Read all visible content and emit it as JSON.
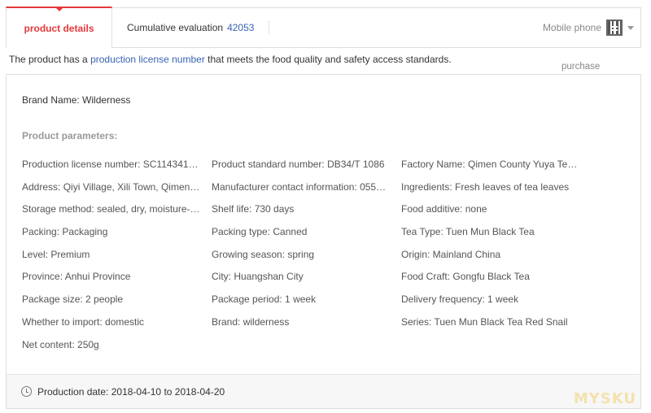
{
  "tabs": {
    "active_label": "product details",
    "eval_label": "Cumulative evaluation",
    "eval_count": "42053",
    "mobile_label": "Mobile phone"
  },
  "license": {
    "prefix": "The product has a ",
    "link": "production license number",
    "suffix": " that meets the food quality and safety access standards."
  },
  "purchase_label": "purchase",
  "brand": "Brand Name: Wilderness",
  "params_title": "Product parameters:",
  "params": [
    "Production license number: SC1143410…",
    "Product standard number: DB34/T 1086",
    "Factory Name: Qimen County Yuya Tea…",
    "Address: Qiyi Village, Xili Town, Qimen …",
    "Manufacturer contact information: 055…",
    "Ingredients: Fresh leaves of tea leaves",
    "Storage method: sealed, dry, moisture-…",
    "Shelf life: 730 days",
    "Food additive: none",
    "Packing: Packaging",
    "Packing type: Canned",
    "Tea Type: Tuen Mun Black Tea",
    "Level: Premium",
    "Growing season: spring",
    "Origin: Mainland China",
    "Province: Anhui Province",
    "City: Huangshan City",
    "Food Craft: Gongfu Black Tea",
    "Package size: 2 people",
    "Package period: 1 week",
    "Delivery frequency: 1 week",
    "Whether to import: domestic",
    "Brand: wilderness",
    "Series: Tuen Mun Black Tea Red Snail",
    "Net content: 250g"
  ],
  "production_date": "Production date: 2018-04-10 to 2018-04-20",
  "watermark": "MYSKU",
  "colors": {
    "accent": "#e4393c",
    "link": "#3a64b4"
  }
}
